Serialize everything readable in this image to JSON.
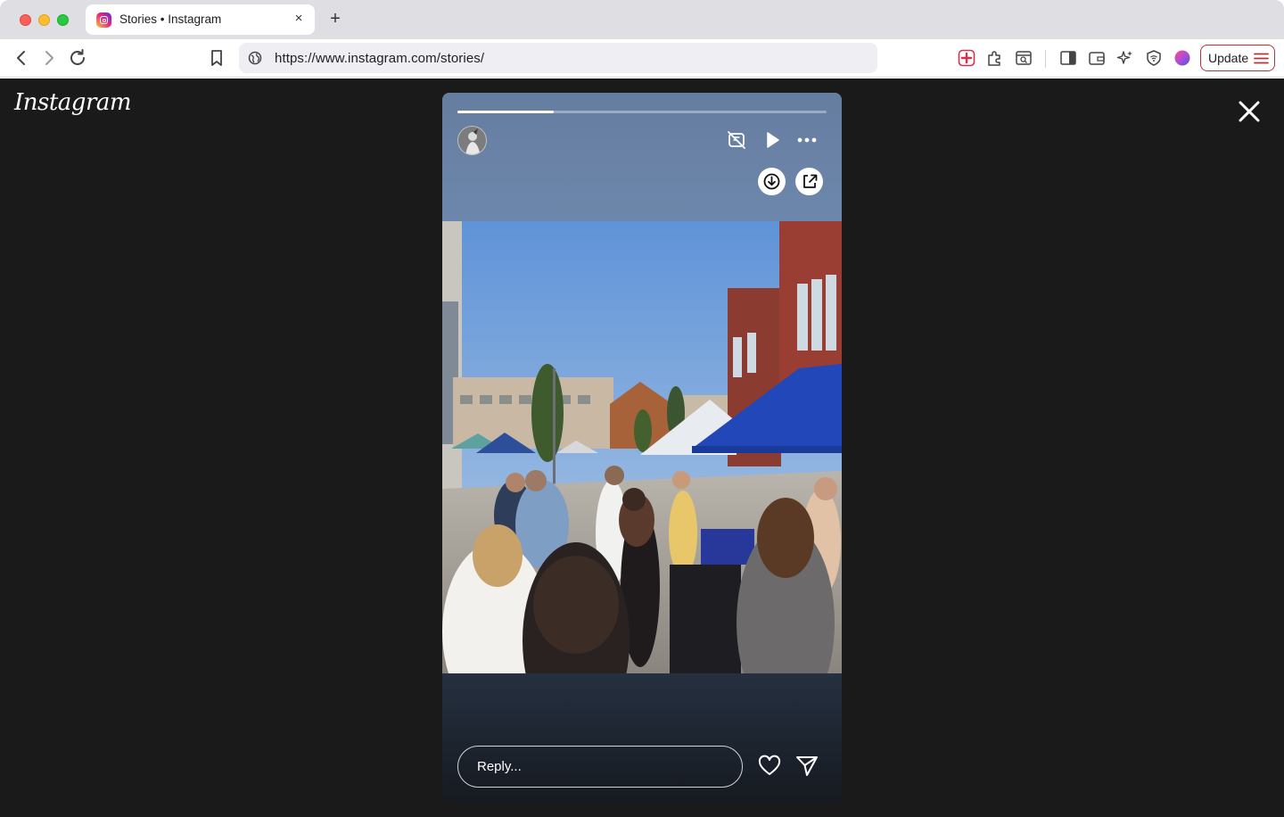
{
  "browser": {
    "tab": {
      "title": "Stories • Instagram",
      "close_glyph": "×",
      "favicon": "instagram-icon"
    },
    "new_tab_glyph": "+",
    "url": "https://www.instagram.com/stories/",
    "update_label": "Update",
    "accent_color": "#b83338"
  },
  "viewer": {
    "logo_text": "Instagram",
    "background_color": "#1a1a1a",
    "close_icon": "close-icon"
  },
  "story": {
    "progress": 0.26,
    "icons": [
      "muted-icon",
      "play-icon",
      "more-icon",
      "download-icon",
      "share-external-icon"
    ],
    "reply_placeholder": "Reply...",
    "like_icon": "heart-icon",
    "send_icon": "send-icon",
    "photo_description_icon": "story-photo"
  }
}
